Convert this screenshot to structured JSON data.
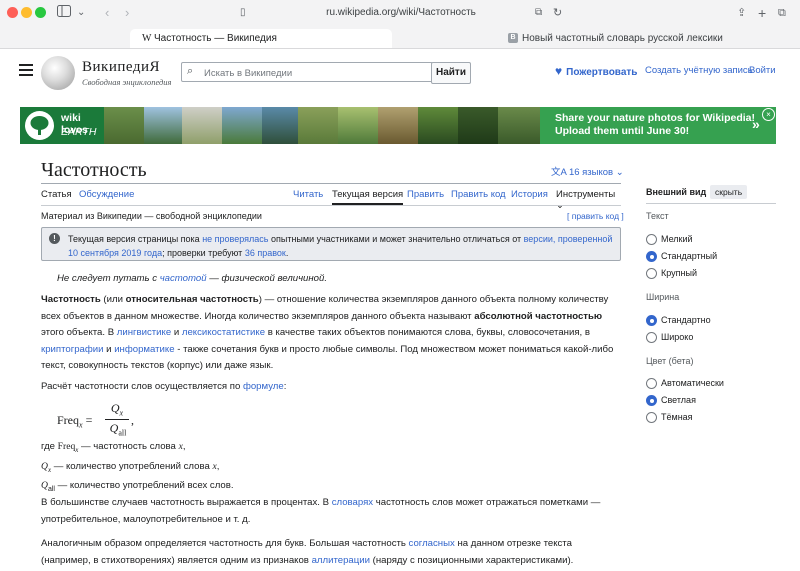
{
  "browser": {
    "url": "ru.wikipedia.org/wiki/Частотность",
    "tabs": [
      {
        "label": "Частотность — Википедия",
        "favicon": "W"
      },
      {
        "label": "Новый частотный словарь русской лексики",
        "favicon": "B"
      }
    ]
  },
  "header": {
    "wordmark": "ВикипедиЯ",
    "tagline": "Свободная энциклопедия",
    "search_placeholder": "Искать в Википедии",
    "search_button": "Найти",
    "donate": "Пожертвовать",
    "create_account": "Создать учётную запись",
    "login": "Войти"
  },
  "banner": {
    "title_line1": "wiki loves",
    "title_line2": "EARTH",
    "message_line1": "Share your nature photos for Wikipedia!",
    "message_line2": "Upload them until June 30!",
    "arrow": "»",
    "close": "×"
  },
  "article": {
    "title": "Частотность",
    "languages": "16 языков",
    "tabs": {
      "article": "Статья",
      "discussion": "Обсуждение",
      "read": "Читать",
      "current_version": "Текущая версия",
      "edit": "Править",
      "edit_code": "Править код",
      "history": "История",
      "tools": "Инструменты"
    },
    "from": "Материал из Википедии — свободной энциклопедии",
    "edit_code_link": "[ править код ]",
    "notice": {
      "t1": "Текущая версия страницы пока ",
      "l1": "не проверялась",
      "t2": " опытными участниками и может значительно отличаться от ",
      "l2": "версии, проверенной 10 сентября 2019 года",
      "t3": "; проверки требуют ",
      "l3": "36 правок",
      "t4": "."
    },
    "hatnote": {
      "t1": "Не следует путать с ",
      "link": "частотой",
      "t2": " — физической величиной."
    },
    "p1": {
      "b1": "Частотность",
      "t1": " (или ",
      "b2": "относительная частотность",
      "t2": ") — отношение количества экземпляров данного объекта полному количеству всех объектов в данном множестве. Иногда количество экземпляров данного объекта называют ",
      "b3": "абсолютной частотностью",
      "t3": " этого объекта. В ",
      "l1": "лингвистике",
      "t4": " и ",
      "l2": "лексикостатистике",
      "t5": " в качестве таких объектов понимаются слова, буквы, словосочетания, в ",
      "l3": "криптографии",
      "t6": " и ",
      "l4": "информатике",
      "t7": " - также сочетания букв и просто любые символы. Под множеством может пониматься какой-либо текст, совокупность текстов (корпус) или даже язык."
    },
    "p2": {
      "t1": "Расчёт частотности слов осуществляется по ",
      "link": "формуле",
      "t2": ":"
    },
    "formula": {
      "lhs": "Freq",
      "sub": "x",
      "num": "Q",
      "num_sub": "x",
      "den": "Q",
      "den_sub": "all"
    },
    "defs": [
      {
        "sym": "Freq",
        "sub": "x",
        "text": " — частотность слова ",
        "var": "x",
        "end": ","
      },
      {
        "sym": "Q",
        "sub": "x",
        "text": " — количество употреблений слова ",
        "var": "x",
        "end": ","
      },
      {
        "sym": "Q",
        "sub": "all",
        "text": " — количество употреблений всех слов.",
        "var": "",
        "end": ""
      }
    ],
    "defs_prefix": "где ",
    "p4": {
      "t1": "В большинстве случаев частотность выражается в процентах. В ",
      "link": "словарях",
      "t2": " частотность слов может отражаться пометками — употребительное, малоупотребительное и т. д."
    },
    "p5": {
      "t1": "Аналогичным образом определяется частотность для букв. Большая частотность ",
      "l1": "согласных",
      "t2": " на данном отрезке текста (например, в стихотворениях) является одним из признаков ",
      "l2": "аллитерации",
      "t3": " (наряду с позиционными характеристиками)."
    }
  },
  "appearance": {
    "heading": "Внешний вид",
    "hide": "скрыть",
    "text_group": "Текст",
    "text_options": [
      "Мелкий",
      "Стандартный",
      "Крупный"
    ],
    "text_selected": 1,
    "width_group": "Ширина",
    "width_options": [
      "Стандартно",
      "Широко"
    ],
    "width_selected": 0,
    "color_group": "Цвет (бета)",
    "color_options": [
      "Автоматически",
      "Светлая",
      "Тёмная"
    ],
    "color_selected": 1
  }
}
